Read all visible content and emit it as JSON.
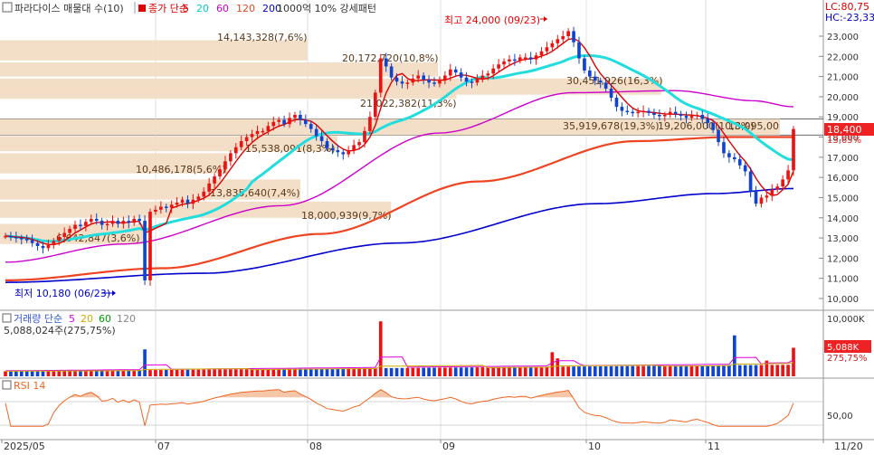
{
  "header": {
    "title": "파라다이스 매물대 수(10)",
    "ma_label": "종가 단순",
    "ma_periods": [
      "5",
      "20",
      "60",
      "120",
      "200"
    ],
    "ma_colors": [
      "#dd0000",
      "#00cccc",
      "#cc00cc",
      "#ee4422",
      "#0000cc"
    ],
    "extra_label": "1000억 10% 강세패턴",
    "lc": "LC:80,75",
    "hc": "HC:-23,33"
  },
  "volume_header": {
    "label": "거래량 단순",
    "periods": [
      "5",
      "20",
      "60",
      "120"
    ],
    "colors": [
      "#dd00dd",
      "#ccaa00",
      "#009900",
      "#888888"
    ],
    "value_text": "5,088,024주(275,75%)"
  },
  "rsi_header": {
    "label": "RSI 14"
  },
  "price_axis": {
    "ticks": [
      "23,000",
      "22,000",
      "21,000",
      "20,000",
      "19,000",
      "18,000",
      "17,000",
      "16,000",
      "15,000",
      "14,000",
      "13,000",
      "12,000",
      "11,000",
      "10,000"
    ],
    "current_price": "18,400",
    "current_change": "13,65%"
  },
  "volume_axis": {
    "top": "10,000K",
    "current": "5,088K",
    "current_pct": "275,75%"
  },
  "rsi_axis": {
    "tick": "50,00"
  },
  "date_axis": [
    "2025/05",
    "07",
    "08",
    "09",
    "10",
    "11",
    "11/20"
  ],
  "annotations": {
    "high": "최고 24,000 (09/23)",
    "low": "최저 10,180 (06/23)"
  },
  "volume_profile": [
    {
      "label": "14,143,328(7,6%)"
    },
    {
      "label": "20,172,720(10,8%)"
    },
    {
      "label": "21,022,382(11,3%)"
    },
    {
      "label": "30,451,926(16,3%)"
    },
    {
      "label": "35,919,678(19,3%)"
    },
    {
      "label": "19,206,000(10,3%)"
    },
    {
      "label": "18,095,00"
    },
    {
      "label": "15,538,091(8,3%)"
    },
    {
      "label": "10,486,178(5,6%)"
    },
    {
      "label": "13,835,640(7,4%)"
    },
    {
      "label": "18,000,939(9,7%)"
    },
    {
      "label": "6,642,847(3,6%)"
    }
  ],
  "chart_data": {
    "type": "candlestick",
    "title": "파라다이스 매물대 수(10)",
    "x_axis_labels": [
      "2025/05",
      "07",
      "08",
      "09",
      "10",
      "11",
      "11/20"
    ],
    "ylim": [
      9500,
      24500
    ],
    "y_ticks": [
      23000,
      22000,
      21000,
      20000,
      19000,
      18000,
      17000,
      16000,
      15000,
      14000,
      13000,
      12000,
      11000,
      10000
    ],
    "ohlc_closes": [
      13100,
      13050,
      13000,
      12950,
      12900,
      12750,
      12600,
      12500,
      12650,
      12850,
      13050,
      13250,
      13450,
      13650,
      13600,
      13800,
      13950,
      13850,
      13650,
      13700,
      13850,
      13700,
      13850,
      13750,
      13950,
      13850,
      10900,
      14300,
      14400,
      14550,
      14500,
      14650,
      14750,
      14900,
      14700,
      14900,
      15050,
      15300,
      15700,
      16050,
      16400,
      16800,
      17200,
      17500,
      17800,
      18000,
      18150,
      18300,
      18300,
      18550,
      18750,
      18850,
      18650,
      18950,
      19100,
      18850,
      18650,
      18400,
      18050,
      17800,
      17450,
      17350,
      17250,
      17150,
      17350,
      17600,
      17750,
      18300,
      19000,
      20200,
      21900,
      21500,
      20950,
      20750,
      20650,
      20700,
      20900,
      21050,
      20850,
      20700,
      20650,
      20850,
      21050,
      21350,
      21200,
      20950,
      20750,
      20700,
      20900,
      21050,
      21150,
      21400,
      21600,
      21750,
      21850,
      21800,
      21950,
      21950,
      21850,
      22050,
      22250,
      22450,
      22650,
      22850,
      23000,
      23250,
      22700,
      21900,
      21300,
      21000,
      20800,
      20700,
      20400,
      19950,
      19500,
      19300,
      19250,
      19200,
      19250,
      19300,
      19200,
      19100,
      19050,
      19100,
      19250,
      19150,
      19050,
      18950,
      19050,
      19100,
      18900,
      18700,
      18350,
      17750,
      17200,
      17000,
      16900,
      16600,
      16300,
      15300,
      14700,
      15000,
      15100,
      15400,
      15550,
      15900,
      16350,
      18400
    ],
    "series": [
      {
        "name": "5",
        "color": "#dd0000",
        "type": "line"
      },
      {
        "name": "20",
        "color": "#00cccc",
        "type": "line"
      },
      {
        "name": "60",
        "color": "#cc00cc",
        "type": "line"
      },
      {
        "name": "120",
        "color": "#ee4422",
        "type": "line"
      },
      {
        "name": "200",
        "color": "#0000cc",
        "type": "line"
      }
    ],
    "volume_profile_levels": [
      {
        "price_from": 19900,
        "price_to": 24000,
        "volume": 14143328,
        "pct": 7.6
      },
      {
        "price_from": 20500,
        "price_to": 21700,
        "volume": 20172720,
        "pct": 10.8
      },
      {
        "price_from": 19400,
        "price_to": 20500,
        "volume": 21022382,
        "pct": 11.3
      },
      {
        "price_from": 20500,
        "price_to": 21000,
        "volume": 30451926,
        "pct": 16.3
      },
      {
        "price_from": 17900,
        "price_to": 19000,
        "volume": 35919678,
        "pct": 19.3
      },
      {
        "price_from": 17200,
        "price_to": 17900,
        "volume": 15538091,
        "pct": 8.3
      },
      {
        "price_from": 16200,
        "price_to": 17200,
        "volume": 10486178,
        "pct": 5.6
      },
      {
        "price_from": 14700,
        "price_to": 16200,
        "volume": 13835640,
        "pct": 7.4
      },
      {
        "price_from": 13700,
        "price_to": 14700,
        "volume": 18000939,
        "pct": 9.7
      },
      {
        "price_from": 12500,
        "price_to": 13700,
        "volume": 6642847,
        "pct": 3.6
      }
    ],
    "high": {
      "value": 24000,
      "date": "09/23"
    },
    "low": {
      "value": 10180,
      "date": "06/23"
    },
    "last_close": 18400,
    "last_change_pct": 13.65,
    "volume_last": 5088024,
    "volume_ylim": [
      0,
      10000000
    ],
    "rsi_reference": 50
  }
}
